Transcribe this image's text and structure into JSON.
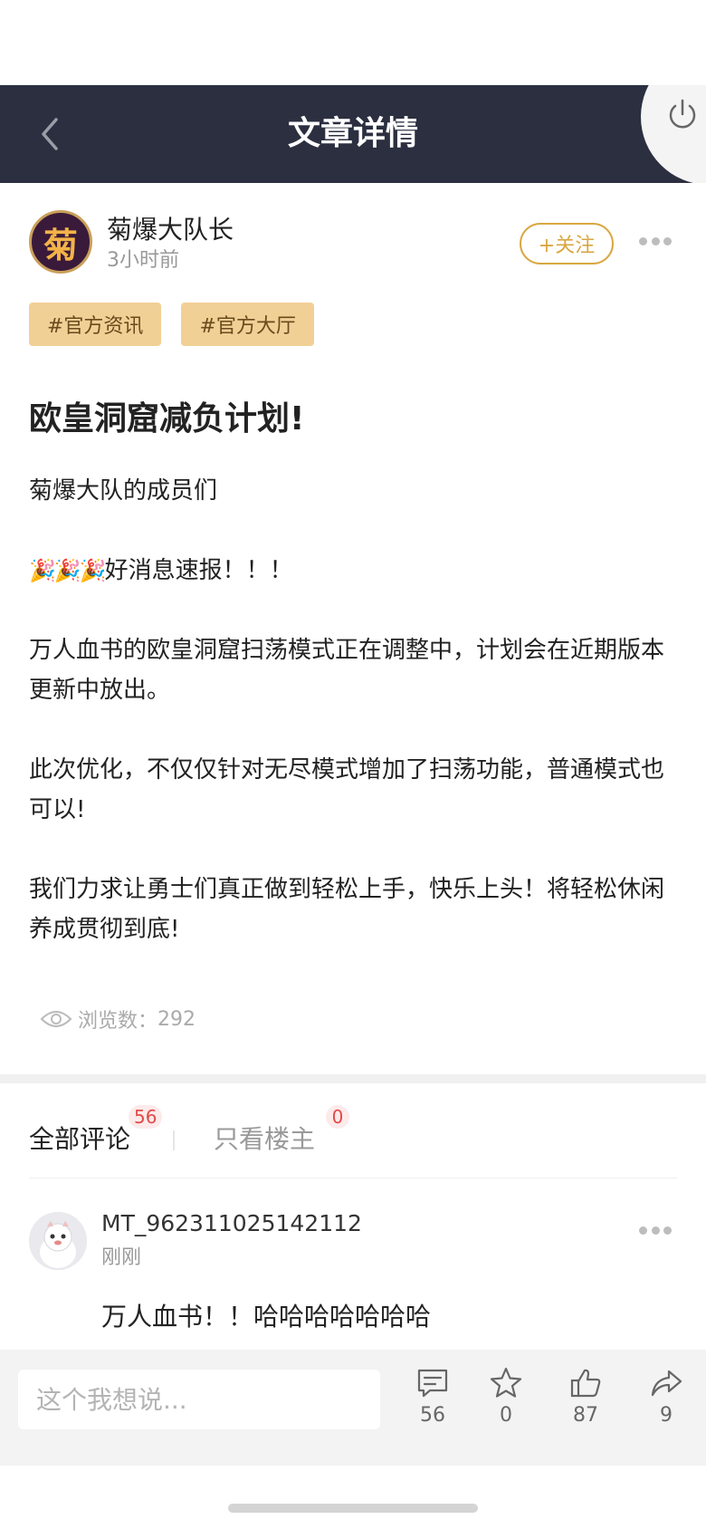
{
  "navbar": {
    "title": "文章详情"
  },
  "author": {
    "avatar_glyph": "菊",
    "name": "菊爆大队长",
    "time": "3小时前",
    "follow_label": "+关注"
  },
  "tags": [
    "#官方资讯",
    "#官方大厅"
  ],
  "post": {
    "title": "欧皇洞窟减负计划!",
    "party_emoji": "🎉🎉🎉",
    "paragraphs": {
      "greeting": "菊爆大队的成员们",
      "headline": "好消息速报！！！",
      "p1": "万人血书的欧皇洞窟扫荡模式正在调整中，计划会在近期版本更新中放出。",
      "p2": "此次优化，不仅仅针对无尽模式增加了扫荡功能，普通模式也可以!",
      "p3": "我们力求让勇士们真正做到轻松上手，快乐上头！将轻松休闲养成贯彻到底!"
    },
    "views_label": "浏览数：",
    "views_count": "292"
  },
  "comment_tabs": {
    "all_label": "全部评论",
    "all_count": "56",
    "owner_label": "只看楼主",
    "owner_count": "0"
  },
  "comments": [
    {
      "user": "MT_962311025142112",
      "time": "刚刚",
      "text": "万人血书！！哈哈哈哈哈哈哈"
    }
  ],
  "bottom_bar": {
    "input_placeholder": "这个我想说...",
    "comment_count": "56",
    "favorite_count": "0",
    "like_count": "87",
    "share_count": "9"
  },
  "colors": {
    "navbar_bg": "#2b2f40",
    "accent_gold": "#d9a741",
    "tag_bg": "#f1d096",
    "badge_red": "#e24a4a"
  },
  "icons": [
    "back-arrow-icon",
    "power-icon",
    "more-icon",
    "eye-icon",
    "comment-icon",
    "star-icon",
    "thumbs-up-icon",
    "share-icon"
  ]
}
